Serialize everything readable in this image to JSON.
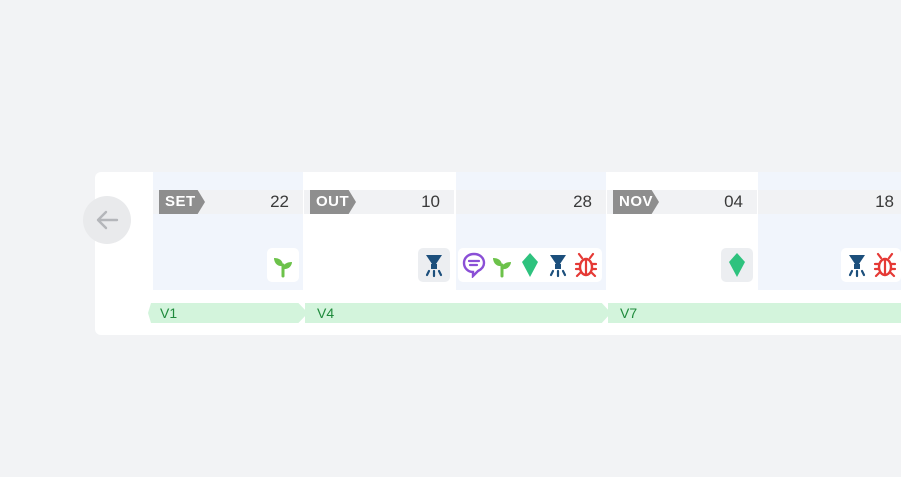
{
  "timeline": {
    "columns": [
      {
        "month": "SET",
        "day": "22",
        "icons": [
          "sprout-icon"
        ]
      },
      {
        "month": "OUT",
        "day": "10",
        "icons": [
          "sprayer-icon"
        ]
      },
      {
        "month": "",
        "day": "28",
        "icons": [
          "comment-icon",
          "sprout-icon",
          "diamond-icon",
          "sprayer-icon",
          "bug-icon"
        ]
      },
      {
        "month": "NOV",
        "day": "04",
        "icons": [
          "diamond-icon"
        ]
      },
      {
        "month": "",
        "day": "18",
        "icons": [
          "sprayer-icon",
          "bug-icon"
        ]
      }
    ],
    "stages": [
      {
        "label": "V1"
      },
      {
        "label": "V4"
      },
      {
        "label": "V7"
      }
    ]
  },
  "colors": {
    "sprout": "#6cc24a",
    "sprayer": "#1c4f7c",
    "comment": "#8a4fd6",
    "diamond": "#2ec27e",
    "bug": "#e53935",
    "stage_band": "#d3f4dc",
    "stage_text": "#1f8a3c"
  }
}
